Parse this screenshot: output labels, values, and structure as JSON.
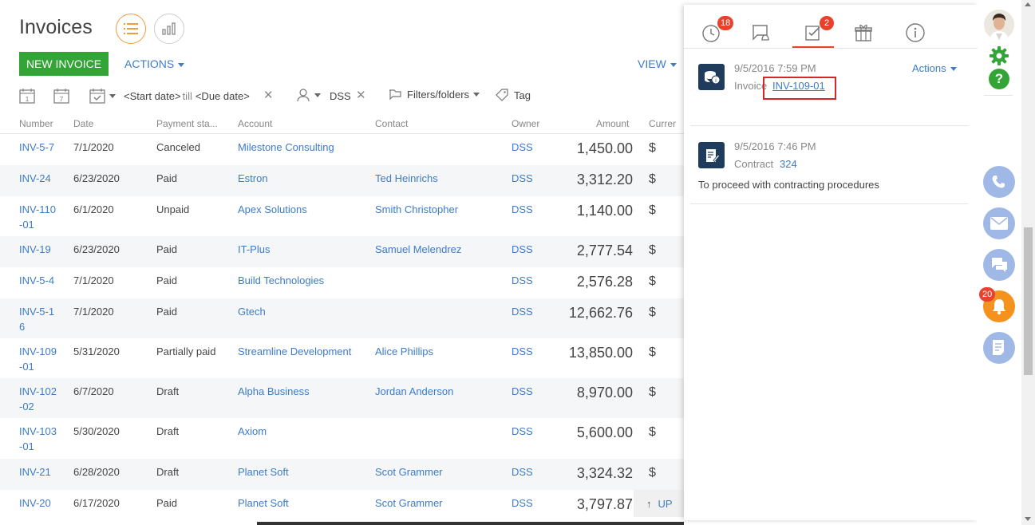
{
  "header": {
    "title": "Invoices",
    "new_button": "NEW INVOICE",
    "actions": "ACTIONS",
    "view": "VIEW"
  },
  "filters": {
    "start_date": "<Start date>",
    "till": "till",
    "due_date": "<Due date>",
    "owner": "DSS",
    "folders": "Filters/folders",
    "tag": "Tag"
  },
  "columns": [
    "Number",
    "Date",
    "Payment sta...",
    "Account",
    "Contact",
    "Owner",
    "Amount",
    "Currer"
  ],
  "rows": [
    {
      "number": [
        "INV-5-7"
      ],
      "date": "7/1/2020",
      "status": "Canceled",
      "account": "Milestone Consulting",
      "contact": "",
      "owner": "DSS",
      "amount": "1,450.00",
      "currency": "$"
    },
    {
      "number": [
        "INV-24"
      ],
      "date": "6/23/2020",
      "status": "Paid",
      "account": "Estron",
      "contact": "Ted Heinrichs",
      "owner": "DSS",
      "amount": "3,312.20",
      "currency": "$"
    },
    {
      "number": [
        "INV-110",
        "-01"
      ],
      "date": "6/1/2020",
      "status": "Unpaid",
      "account": "Apex Solutions",
      "contact": "Smith Christopher",
      "owner": "DSS",
      "amount": "1,140.00",
      "currency": "$"
    },
    {
      "number": [
        "INV-19"
      ],
      "date": "6/23/2020",
      "status": "Paid",
      "account": "IT-Plus",
      "contact": "Samuel Melendrez",
      "owner": "DSS",
      "amount": "2,777.54",
      "currency": "$"
    },
    {
      "number": [
        "INV-5-4"
      ],
      "date": "7/1/2020",
      "status": "Paid",
      "account": "Build Technologies",
      "contact": "",
      "owner": "DSS",
      "amount": "2,576.28",
      "currency": "$"
    },
    {
      "number": [
        "INV-5-1",
        "6"
      ],
      "date": "7/1/2020",
      "status": "Paid",
      "account": "Gtech",
      "contact": "",
      "owner": "DSS",
      "amount": "12,662.76",
      "currency": "$"
    },
    {
      "number": [
        "INV-109",
        "-01"
      ],
      "date": "5/31/2020",
      "status": "Partially paid",
      "account": "Streamline Development",
      "contact": "Alice Phillips",
      "owner": "DSS",
      "amount": "13,850.00",
      "currency": "$"
    },
    {
      "number": [
        "INV-102",
        "-02"
      ],
      "date": "6/7/2020",
      "status": "Draft",
      "account": "Alpha Business",
      "contact": "Jordan Anderson",
      "owner": "DSS",
      "amount": "8,970.00",
      "currency": "$"
    },
    {
      "number": [
        "INV-103",
        "-01"
      ],
      "date": "5/30/2020",
      "status": "Draft",
      "account": "Axiom",
      "contact": "",
      "owner": "DSS",
      "amount": "5,600.00",
      "currency": "$"
    },
    {
      "number": [
        "INV-21"
      ],
      "date": "6/28/2020",
      "status": "Draft",
      "account": "Planet Soft",
      "contact": "Scot Grammer",
      "owner": "DSS",
      "amount": "3,324.32",
      "currency": "$"
    },
    {
      "number": [
        "INV-20"
      ],
      "date": "6/17/2020",
      "status": "Paid",
      "account": "Planet Soft",
      "contact": "Scot Grammer",
      "owner": "DSS",
      "amount": "3,797.87",
      "currency": "$"
    }
  ],
  "up_button": "UP",
  "panel": {
    "tab_badges": {
      "reminders": "18",
      "tasks": "2"
    },
    "feed": [
      {
        "time": "9/5/2016 7:59 PM",
        "type": "Invoice",
        "link": "INV-109-01",
        "actions": "Actions",
        "text": ""
      },
      {
        "time": "9/5/2016 7:46 PM",
        "type": "Contract",
        "link": "324",
        "actions": "",
        "text": "To proceed with contracting procedures"
      }
    ]
  },
  "rail": {
    "notification_badge": "20"
  },
  "colors": {
    "primary_green": "#33a537",
    "link_blue": "#3d7cc9",
    "badge_red": "#e8412c",
    "notify_orange": "#f5921e",
    "rail_blue": "#9fb8e6",
    "icon_navy": "#1f3c5c"
  },
  "icons": [
    "list-view-icon",
    "chart-view-icon",
    "calendar-day-icon",
    "calendar-week-icon",
    "calendar-check-icon",
    "user-icon",
    "folder-filter-icon",
    "tag-icon",
    "alarm-clock-icon",
    "chat-bell-icon",
    "task-check-icon",
    "gift-icon",
    "info-icon",
    "coins-icon",
    "contract-icon",
    "settings-gear-icon",
    "help-icon",
    "phone-icon",
    "email-icon",
    "chat-icon",
    "bell-icon",
    "document-icon"
  ]
}
